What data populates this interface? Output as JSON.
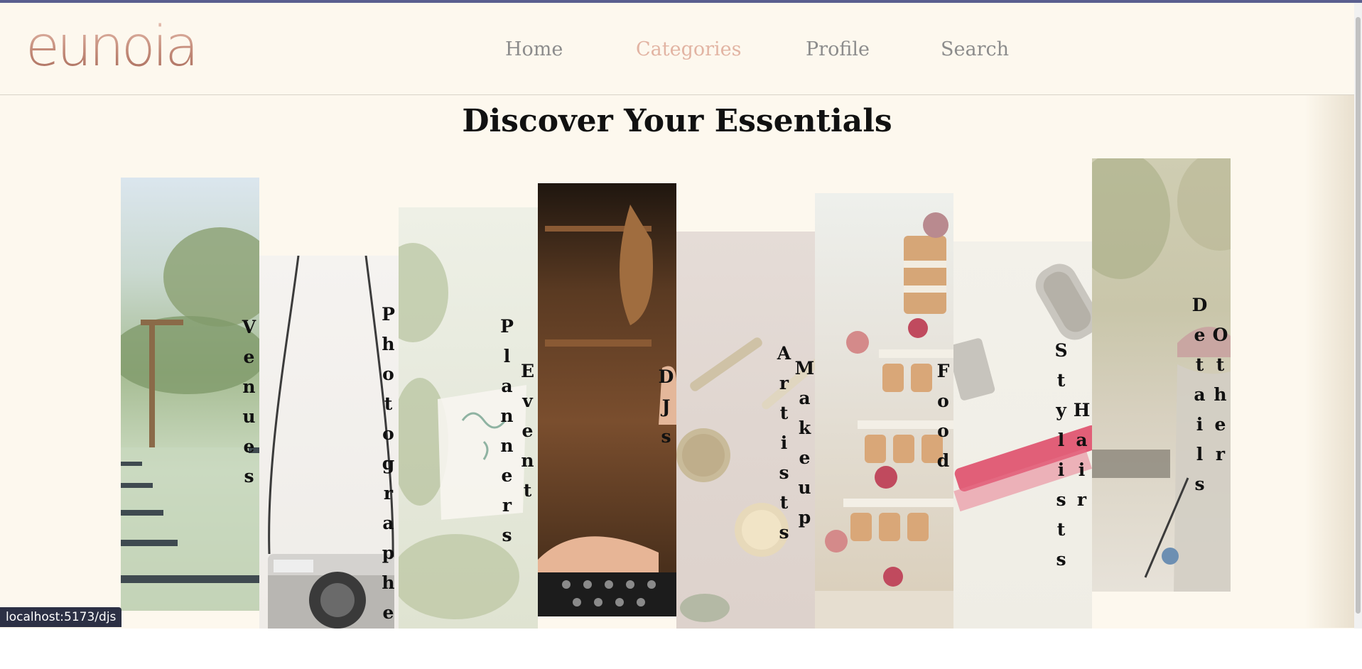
{
  "brand": {
    "logo_text": "eunoia"
  },
  "nav": {
    "home": "Home",
    "categories": "Categories",
    "profile": "Profile",
    "search": "Search",
    "active": "Categories",
    "active_color": "#e2b4a3",
    "inactive_color": "#8c8c8c"
  },
  "main": {
    "title": "Discover Your Essentials"
  },
  "categories": [
    {
      "label": "Venues"
    },
    {
      "label": "Photographer"
    },
    {
      "label": "Event Planners"
    },
    {
      "label": "DJs"
    },
    {
      "label": "Makeup Artists"
    },
    {
      "label": "Food"
    },
    {
      "label": "Hair Stylists"
    },
    {
      "label": "Other Details"
    }
  ],
  "status_bar": {
    "url": "localhost:5173/djs"
  },
  "colors": {
    "page_background": "#fdf8ee",
    "accent": "#e2b4a3",
    "status_bar": "#2c3044"
  }
}
